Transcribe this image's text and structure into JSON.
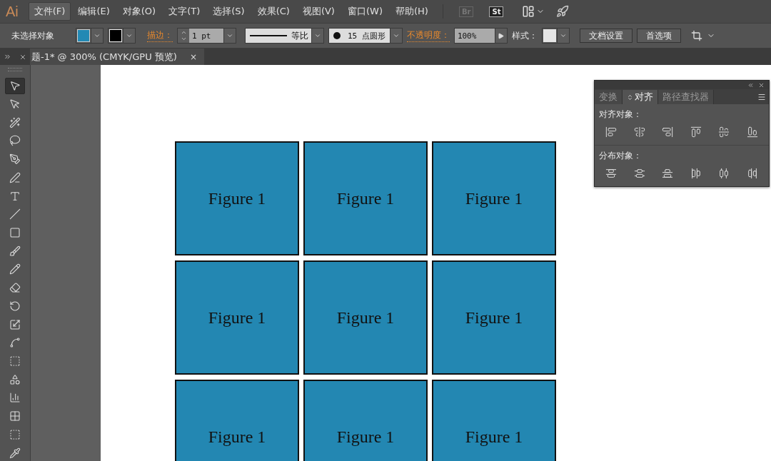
{
  "menu_bar": {
    "logo": "Ai",
    "items": [
      {
        "label": "文件(F)",
        "selected": true
      },
      {
        "label": "编辑(E)",
        "selected": false
      },
      {
        "label": "对象(O)",
        "selected": false
      },
      {
        "label": "文字(T)",
        "selected": false
      },
      {
        "label": "选择(S)",
        "selected": false
      },
      {
        "label": "效果(C)",
        "selected": false
      },
      {
        "label": "视图(V)",
        "selected": false
      },
      {
        "label": "窗口(W)",
        "selected": false
      },
      {
        "label": "帮助(H)",
        "selected": false
      }
    ],
    "app_buttons": [
      {
        "label": "Br",
        "disabled": true
      },
      {
        "label": "St",
        "disabled": false
      }
    ]
  },
  "control_bar": {
    "selection": "未选择对象",
    "stroke_label": "描边：",
    "stroke_weight": "1 pt",
    "stroke_profile": "等比",
    "brush": "15 点圆形",
    "opacity_label": "不透明度：",
    "opacity": "100%",
    "style_label": "样式：",
    "buttons": [
      "文档设置",
      "首选项"
    ]
  },
  "document_tab": {
    "title": "题-1* @ 300% (CMYK/GPU 预览)",
    "close": "×"
  },
  "tools": [
    {
      "selected": true
    },
    {
      "selected": false
    },
    {
      "selected": false
    },
    {
      "selected": false
    },
    {
      "selected": false
    },
    {
      "selected": false
    },
    {
      "selected": false
    },
    {
      "selected": false
    },
    {
      "selected": false
    },
    {
      "selected": false
    },
    {
      "selected": false
    },
    {
      "selected": false
    },
    {
      "selected": false
    },
    {
      "selected": false
    },
    {
      "selected": false
    },
    {
      "selected": false
    },
    {
      "selected": false
    },
    {
      "selected": false
    },
    {
      "selected": false
    },
    {
      "selected": false
    },
    {
      "selected": false
    }
  ],
  "figures": [
    "Figure 1",
    "Figure 1",
    "Figure 1",
    "Figure 1",
    "Figure 1",
    "Figure 1",
    "Figure 1",
    "Figure 1",
    "Figure 1"
  ],
  "align_panel": {
    "tabs": [
      {
        "label": "变换",
        "selected": false
      },
      {
        "label": "对齐",
        "selected": true
      },
      {
        "label": "路径查找器",
        "selected": false
      }
    ],
    "sections": [
      {
        "title": "对齐对象：",
        "kind": "align"
      },
      {
        "title": "分布对象：",
        "kind": "distribute"
      }
    ]
  }
}
